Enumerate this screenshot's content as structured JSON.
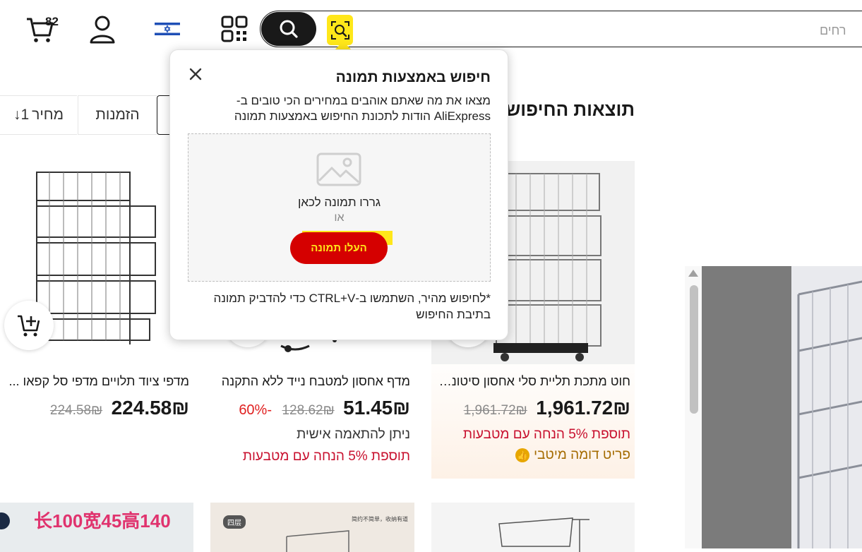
{
  "header": {
    "search_placeholder": "רחים",
    "cart_count": "82",
    "icons": [
      "search-icon",
      "camera-search-icon",
      "qr-code-icon",
      "israel-flag-icon",
      "account-icon",
      "cart-icon"
    ]
  },
  "results": {
    "title": "תוצאות החיפוש",
    "sort_tabs": [
      "מחיר",
      "הזמנות"
    ],
    "sort_price_arrows": "↓1"
  },
  "products": [
    {
      "title": "חוט מתכת תליית סלי אחסון סיטונאות",
      "price": "1,961.72₪",
      "old_price": "1,961.72₪",
      "line1": "תוספת 5% הנחה עם מטבעות",
      "line2": "פריט דומה מיטבי"
    },
    {
      "title": "מדף אחסון למטבח נייד ללא התקנה",
      "price": "51.45₪",
      "old_price": "128.62₪",
      "discount": "-60%",
      "line1": "ניתן להתאמה אישית",
      "line2": "תוספת 5% הנחה עם מטבעות"
    },
    {
      "title": "מדפי ציוד תלויים מדפי סל קפאו ...",
      "price": "224.58₪",
      "old_price": "224.58₪"
    }
  ],
  "bottom_row_texts": {
    "card_b2_badge": "四层",
    "card_b2_caption": "简约不简单，收纳有道",
    "card_b3_banner": "长100宽45高140"
  },
  "popup": {
    "title": "חיפוש באמצעות תמונה",
    "description": "מצאו את מה שאתם אוהבים במחירים הכי טובים ב-AliExpress הודות לתכונת החיפוש באמצעות תמונה",
    "drop_label": "גררו תמונה לכאן",
    "or_label": "או",
    "upload_button": "העלו תמונה",
    "tip": "*לחיפוש מהיר, השתמשו ב-CTRL+V כדי להדביק תמונה בתיבת החיפוש"
  },
  "colors": {
    "accent_yellow": "#ffe71a",
    "upload_red": "#d50000",
    "promo_red": "#c8102e",
    "text": "#191919"
  }
}
